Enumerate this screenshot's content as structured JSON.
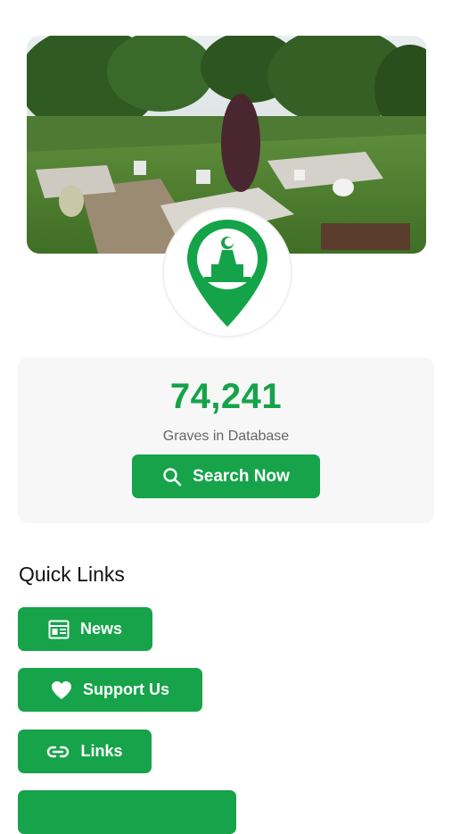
{
  "hero": {
    "image_subject": "cemetery-graves-photo"
  },
  "logo": {
    "icon": "map-pin-grave-icon",
    "color": "#15a34a"
  },
  "stats": {
    "count": "74,241",
    "label": "Graves in Database",
    "search_label": "Search Now",
    "search_icon": "search-icon"
  },
  "quick_links": {
    "title": "Quick Links",
    "items": [
      {
        "label": "News",
        "icon": "newspaper-icon"
      },
      {
        "label": "Support Us",
        "icon": "heart-icon"
      },
      {
        "label": "Links",
        "icon": "link-icon"
      },
      {
        "label": "",
        "icon": ""
      }
    ]
  },
  "colors": {
    "accent": "#16a34a",
    "card": "#f7f7f7"
  }
}
